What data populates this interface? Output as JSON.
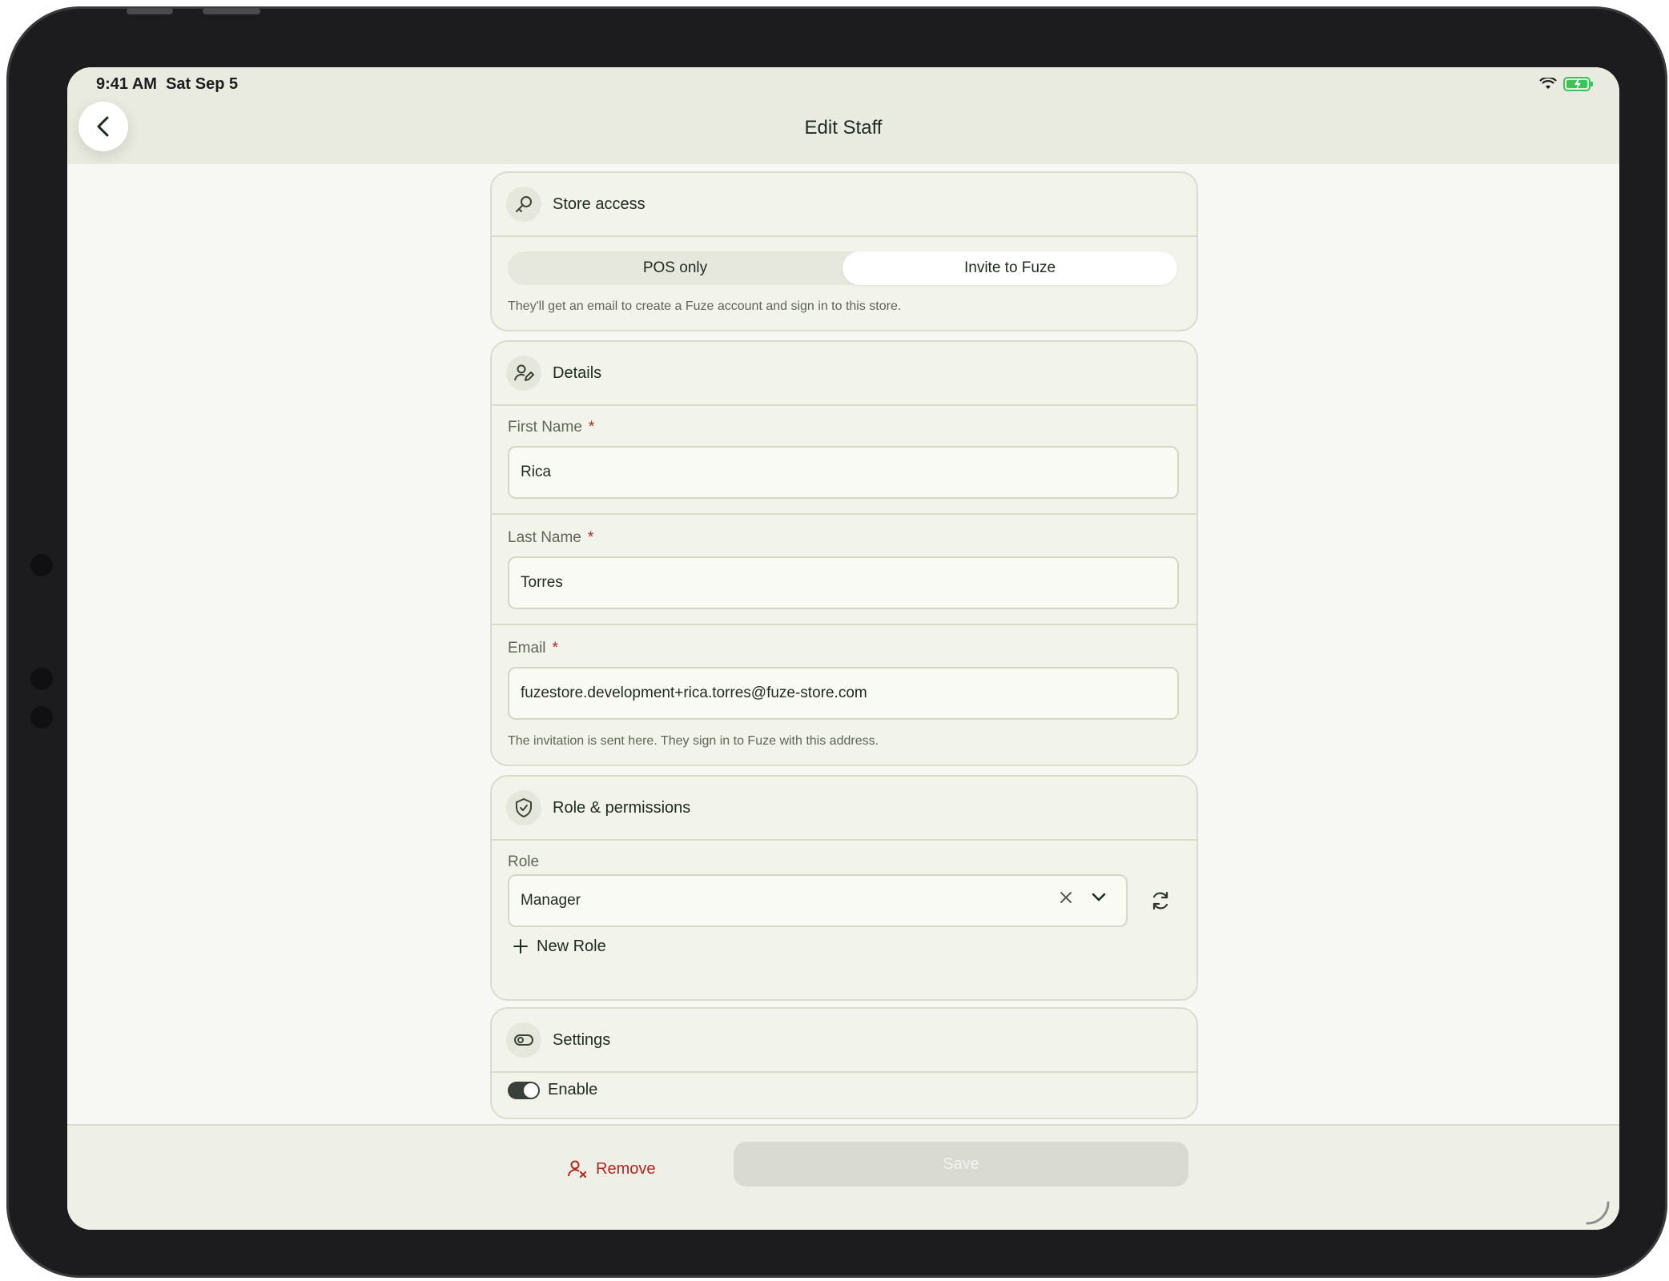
{
  "status": {
    "time": "9:41 AM",
    "date": "Sat Sep 5"
  },
  "header": {
    "title": "Edit Staff"
  },
  "store_access": {
    "title": "Store access",
    "segments": [
      "POS only",
      "Invite to Fuze"
    ],
    "selected": "Invite to Fuze",
    "hint": "They'll get an email to create a Fuze account and sign in to this store."
  },
  "details": {
    "title": "Details",
    "first_name_label": "First Name",
    "first_name_value": "Rica",
    "last_name_label": "Last Name",
    "last_name_value": "Torres",
    "email_label": "Email",
    "email_value": "fuzestore.development+rica.torres@fuze-store.com",
    "email_hint": "The invitation is sent here. They sign in to Fuze with this address.",
    "required_mark": "*"
  },
  "role": {
    "title": "Role & permissions",
    "label": "Role",
    "value": "Manager",
    "new_role_label": "New Role"
  },
  "settings": {
    "title": "Settings",
    "enable_label": "Enable",
    "enabled": true
  },
  "footer": {
    "remove_label": "Remove",
    "save_label": "Save"
  },
  "colors": {
    "danger": "#b3261e",
    "surface": "#f2f3ea",
    "topbar": "#e9ebe0"
  },
  "icons": [
    "back-chevron-icon",
    "key-icon",
    "user-edit-icon",
    "shield-icon",
    "toggle-icon",
    "clear-icon",
    "chevron-down-icon",
    "refresh-icon",
    "plus-icon",
    "user-remove-icon",
    "wifi-icon",
    "battery-icon"
  ]
}
